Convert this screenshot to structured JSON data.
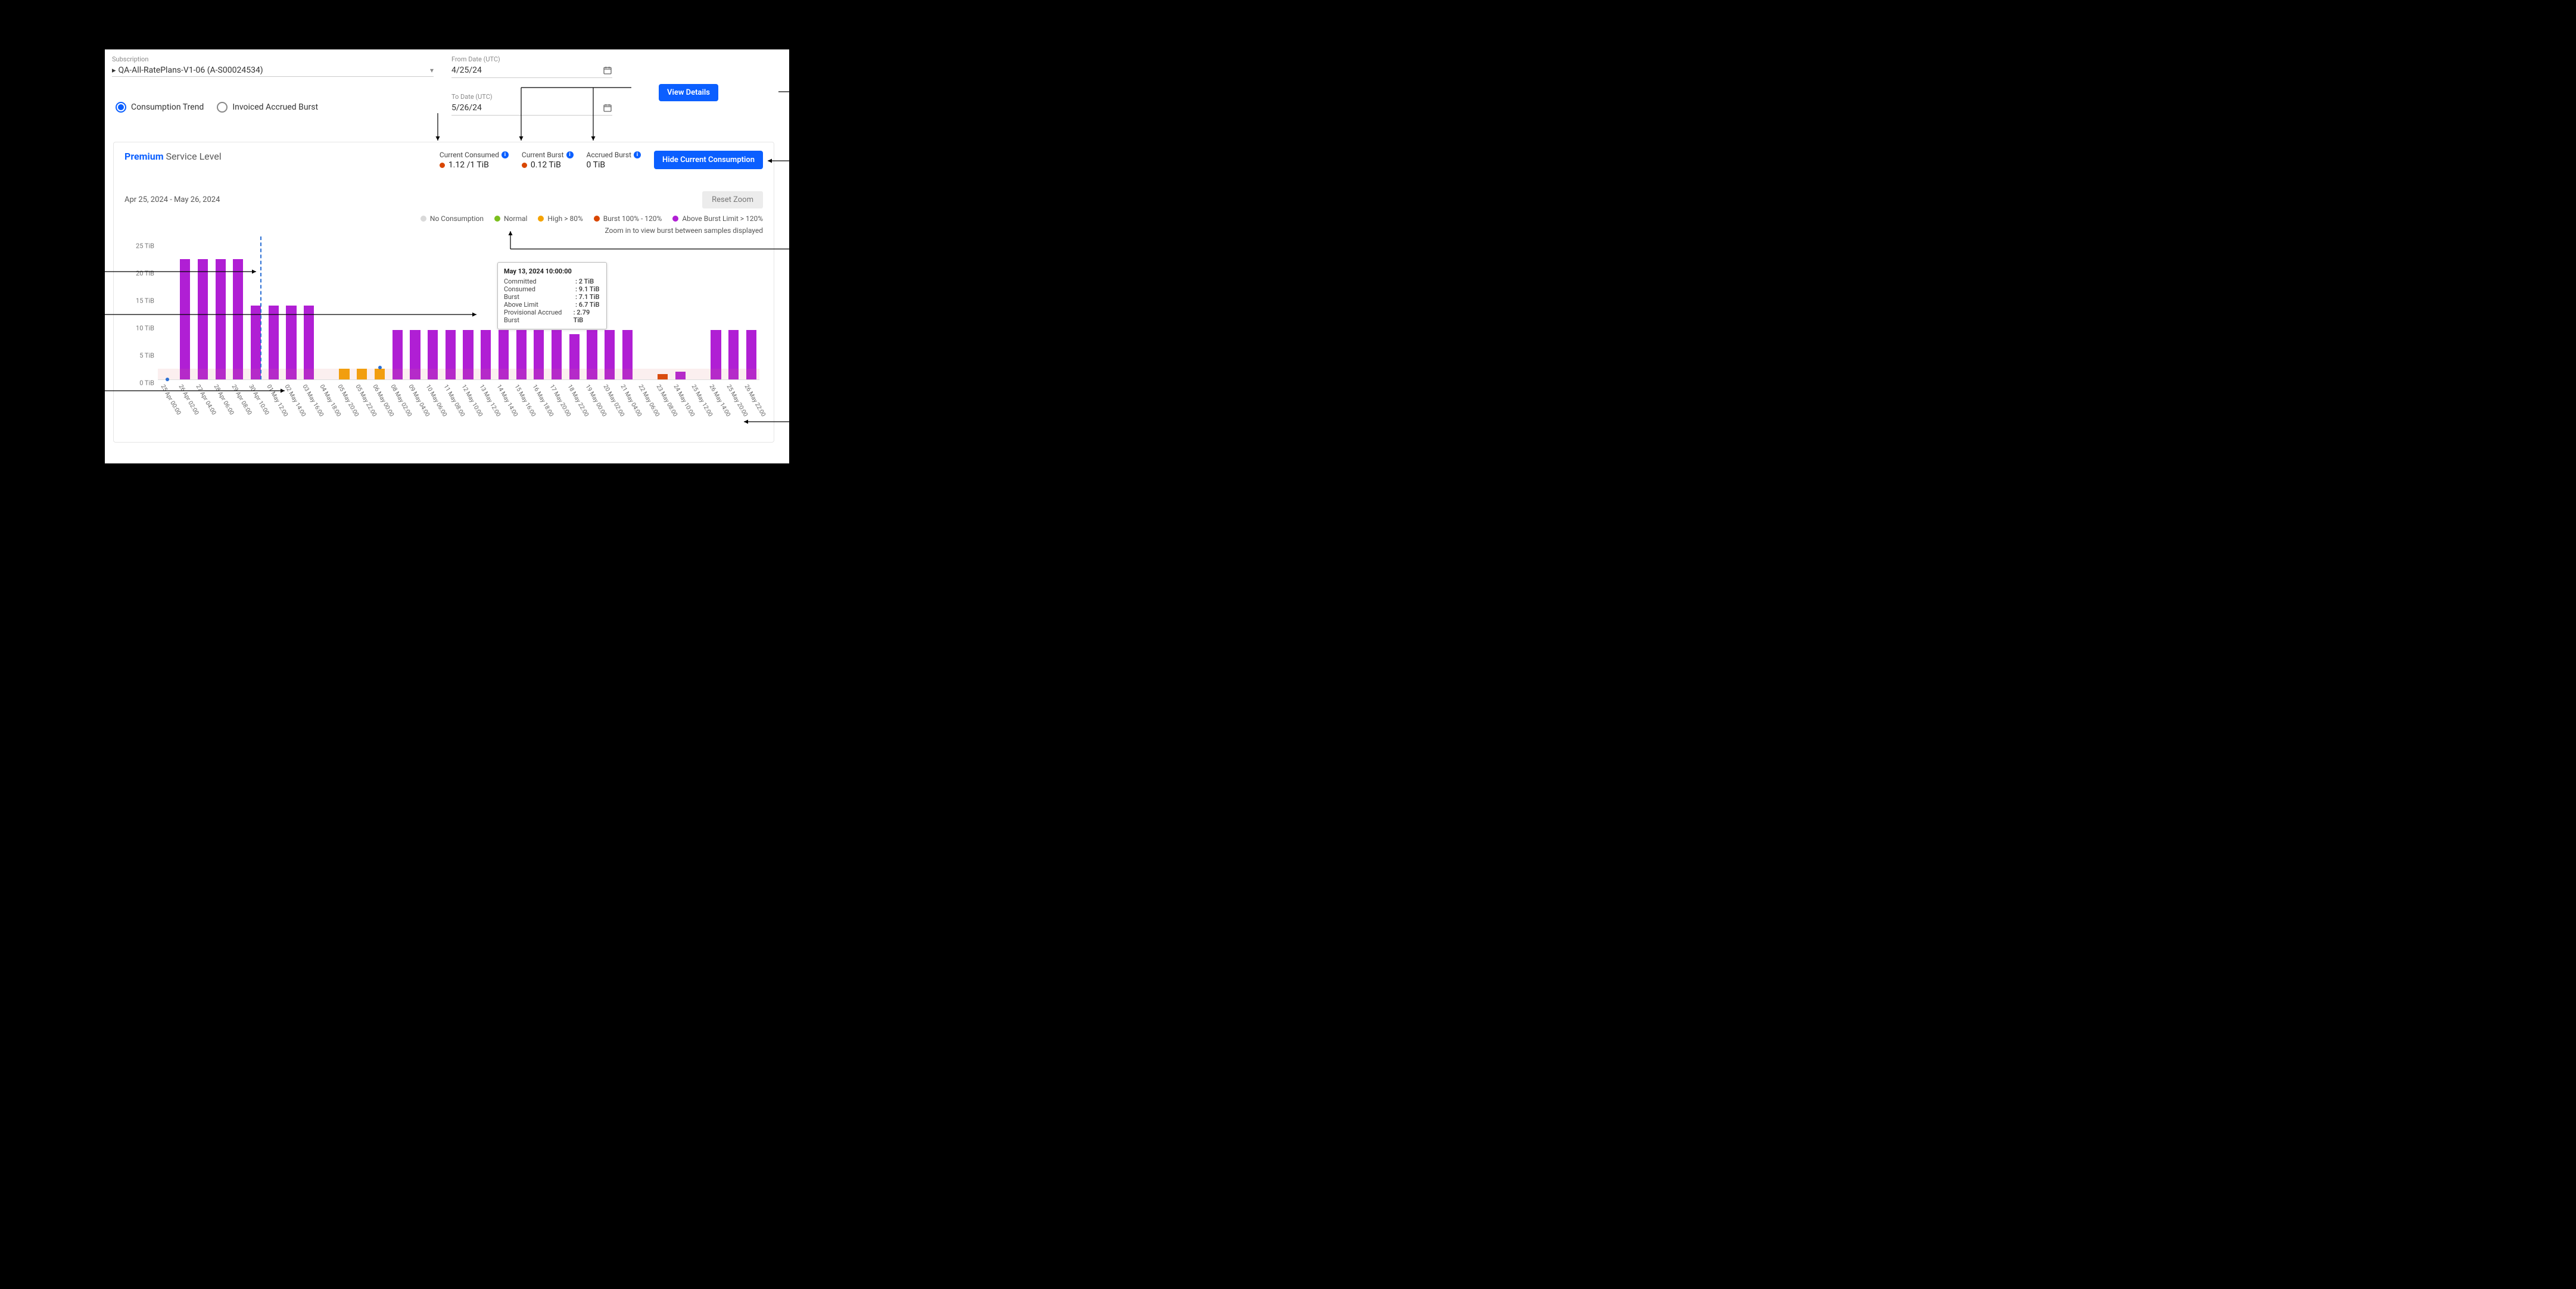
{
  "header": {
    "subscription_label": "Subscription",
    "subscription_value": "QA-All-RatePlans-V1-06 (A-S00024534)",
    "from_label": "From Date (UTC)",
    "from_value": "4/25/24",
    "to_label": "To Date (UTC)",
    "to_value": "5/26/24",
    "view_details": "View Details",
    "radio_consumption": "Consumption Trend",
    "radio_invoiced": "Invoiced Accrued Burst"
  },
  "card": {
    "service_level_prefix": "Premium",
    "service_level_rest": " Service Level",
    "metrics": {
      "consumed_label": "Current Consumed",
      "consumed_value": "1.12 /1 TiB",
      "consumed_color": "#d94600",
      "burst_label": "Current Burst",
      "burst_value": "0.12 TiB",
      "burst_color": "#d94600",
      "accrued_label": "Accrued Burst",
      "accrued_value": "0 TiB"
    },
    "hide_btn": "Hide Current Consumption",
    "range_text": "Apr 25, 2024 - May 26, 2024",
    "reset_btn": "Reset Zoom",
    "legend": {
      "no_consumption": "No Consumption",
      "no_consumption_color": "#d9d9d9",
      "normal": "Normal",
      "normal_color": "#7bbf1e",
      "high": "High > 80%",
      "high_color": "#f5a300",
      "burst": "Burst 100% - 120%",
      "burst_color": "#d94600",
      "above": "Above Burst Limit > 120%",
      "above_color": "#b01fd4",
      "zoom_note": "Zoom in to view burst between samples displayed",
      "zoom_color": "#0b5fff"
    }
  },
  "tooltip": {
    "title": "May 13, 2024 10:00:00",
    "committed_k": "Committed",
    "committed_v": ": 2 TiB",
    "consumed_k": "Consumed",
    "consumed_v": ": 9.1 TiB",
    "burst_k": "Burst",
    "burst_v": ": 7.1 TiB",
    "above_k": "Above Limit",
    "above_v": ": 6.7 TiB",
    "prov_k": "Provisional Accrued Burst",
    "prov_v": ": 2.79 TiB"
  },
  "chart_data": {
    "type": "bar",
    "title": "Consumption Trend",
    "ylabel": "TiB",
    "ylim": [
      0,
      25
    ],
    "yticks": [
      0,
      5,
      10,
      15,
      20,
      25
    ],
    "ytick_labels": [
      "0 TiB",
      "5 TiB",
      "10 TiB",
      "15 TiB",
      "20 TiB",
      "25 TiB"
    ],
    "categories": [
      "25 Apr 00:00",
      "26 Apr 02:00",
      "27 Apr 04:00",
      "28 Apr 06:00",
      "29 Apr 08:00",
      "30 Apr 10:00",
      "01 May 12:00",
      "02 May 14:00",
      "03 May 16:00",
      "04 May 18:00",
      "05 May 20:00",
      "05 May 22:00",
      "06 May 00:00",
      "08 May 02:00",
      "09 May 04:00",
      "10 May 06:00",
      "11 May 08:00",
      "12 May 10:00",
      "13 May 12:00",
      "14 May 14:00",
      "15 May 16:00",
      "16 May 18:00",
      "17 May 20:00",
      "18 May 22:00",
      "19 May 00:00",
      "20 May 02:00",
      "21 May 04:00",
      "22 May 06:00",
      "23 May 08:00",
      "24 May 10:00",
      "25 May 12:00",
      "26 May 14:00",
      "25 May 20:00",
      "26 May 22:00"
    ],
    "values": [
      0,
      22,
      22,
      22,
      22,
      13.5,
      13.5,
      13.5,
      13.5,
      0,
      2,
      2,
      2,
      9,
      9,
      9,
      9,
      9,
      9,
      9,
      9,
      9,
      9,
      8.3,
      9,
      9,
      9,
      0,
      1,
      1.4,
      0,
      9,
      9,
      9
    ],
    "status": [
      "none",
      "above",
      "above",
      "above",
      "above",
      "above",
      "above",
      "above",
      "above",
      "none",
      "high",
      "high",
      "high",
      "above",
      "above",
      "above",
      "above",
      "above",
      "above",
      "above",
      "above",
      "above",
      "above",
      "above",
      "above",
      "above",
      "above",
      "none",
      "burst",
      "above",
      "none",
      "above",
      "above",
      "above"
    ],
    "colors": {
      "none": "transparent",
      "normal": "#7bbf1e",
      "high": "#f5a300",
      "burst": "#d94600",
      "above": "#b01fd4"
    }
  }
}
